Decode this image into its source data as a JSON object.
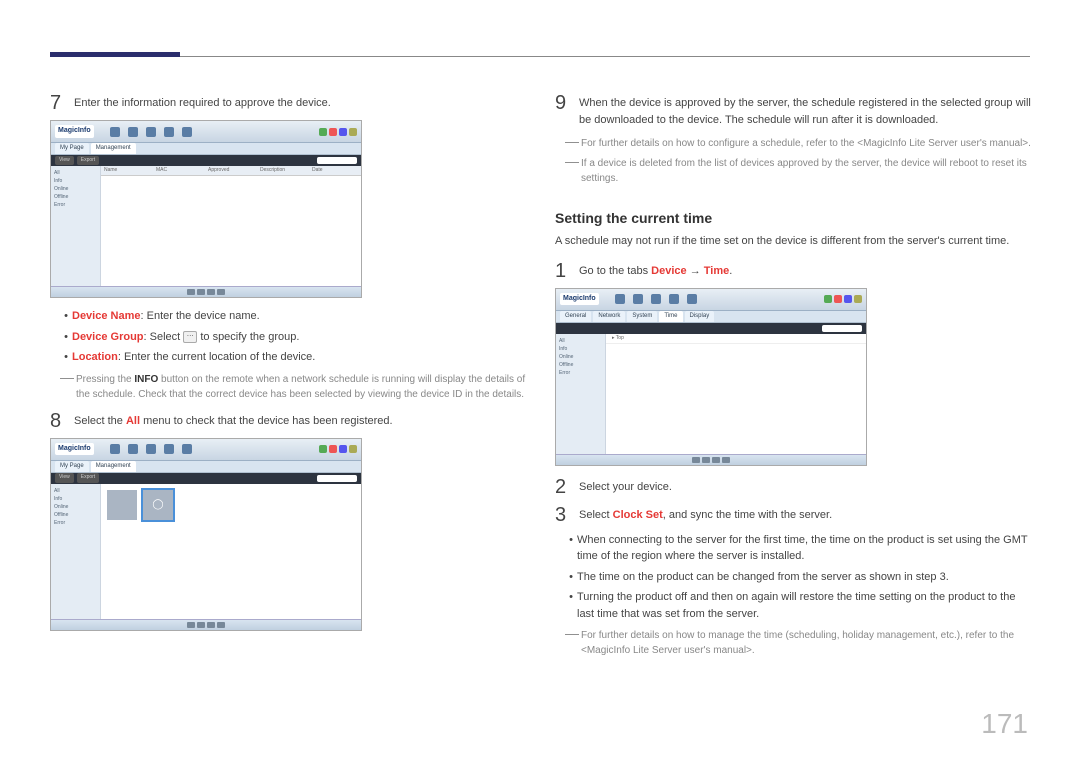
{
  "pageNumber": "171",
  "left": {
    "step7": {
      "num": "7",
      "text": "Enter the information required to approve the device."
    },
    "bullets": {
      "deviceNameLabel": "Device Name",
      "deviceNameText": ": Enter the device name.",
      "deviceGroupLabel": "Device Group",
      "deviceGroupPre": ": Select ",
      "deviceGroupPost": " to specify the group.",
      "locationLabel": "Location",
      "locationText": ": Enter the current location of the device."
    },
    "note1a": "Pressing the ",
    "note1b": "INFO",
    "note1c": " button on the remote when a network schedule is running will display the details of the schedule. Check that the correct device has been selected by viewing the device ID in the details.",
    "step8": {
      "num": "8",
      "textA": "Select the ",
      "textB": "All",
      "textC": " menu to check that the device has been registered."
    },
    "ss": {
      "logo": "MagicInfo",
      "navTabs": [
        "My Page",
        "Management"
      ],
      "actions": [
        "View",
        "Export"
      ],
      "side": [
        "All",
        "Info",
        "Online",
        "Offline",
        "Error"
      ],
      "cols": [
        "Name",
        "MAC",
        "Approved",
        "Description",
        "Date"
      ]
    }
  },
  "right": {
    "step9": {
      "num": "9",
      "text": "When the device is approved by the server, the schedule registered in the selected group will be downloaded to the device. The schedule will run after it is downloaded."
    },
    "note2": "For further details on how to configure a schedule, refer to the <MagicInfo Lite Server user's manual>.",
    "note3": "If a device is deleted from the list of devices approved by the server, the device will reboot to reset its settings.",
    "sectionTitle": "Setting the current time",
    "sectionSub": "A schedule may not run if the time set on the device is different from the server's current time.",
    "step1": {
      "num": "1",
      "textA": "Go to the tabs ",
      "textB": "Device",
      "arrow": " → ",
      "textC": "Time",
      "textD": "."
    },
    "step2": {
      "num": "2",
      "text": "Select your device."
    },
    "step3": {
      "num": "3",
      "textA": "Select ",
      "textB": "Clock Set",
      "textC": ", and sync the time with the server."
    },
    "bulletsB": {
      "b1": "When connecting to the server for the first time, the time on the product is set using the GMT time of the region where the server is installed.",
      "b2": "The time on the product can be changed from the server as shown in step 3.",
      "b3": "Turning the product off and then on again will restore the time setting on the product to the last time that was set from the server."
    },
    "note4": "For further details on how to manage the time (scheduling, holiday management, etc.), refer to the <MagicInfo Lite Server user's manual>.",
    "ss": {
      "logo": "MagicInfo",
      "tabs": [
        "General",
        "Network",
        "System",
        "Time",
        "Display"
      ],
      "side": [
        "All",
        "Info",
        "Online",
        "Offline",
        "Error"
      ],
      "tree": [
        "▸ Top"
      ]
    }
  }
}
